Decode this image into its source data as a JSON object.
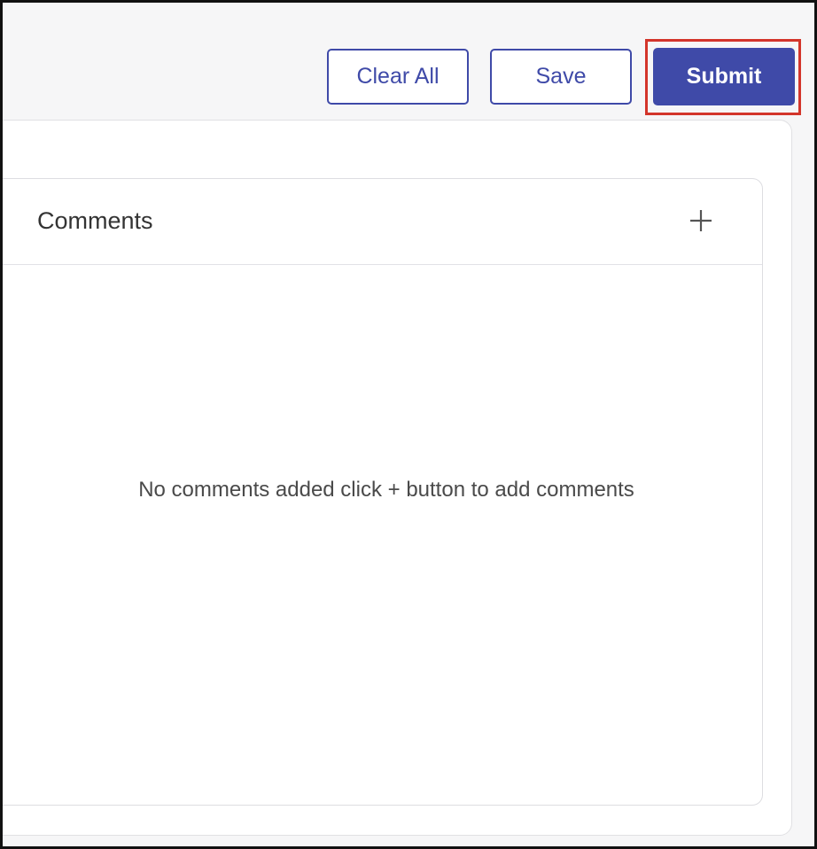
{
  "toolbar": {
    "clear_all_label": "Clear All",
    "save_label": "Save",
    "submit_label": "Submit"
  },
  "comments": {
    "title": "Comments",
    "add_icon": "plus-icon",
    "empty_message": "No comments added click + button to add comments"
  },
  "colors": {
    "primary": "#3f4aa8",
    "highlight": "#d3352b",
    "background": "#f6f6f7"
  }
}
